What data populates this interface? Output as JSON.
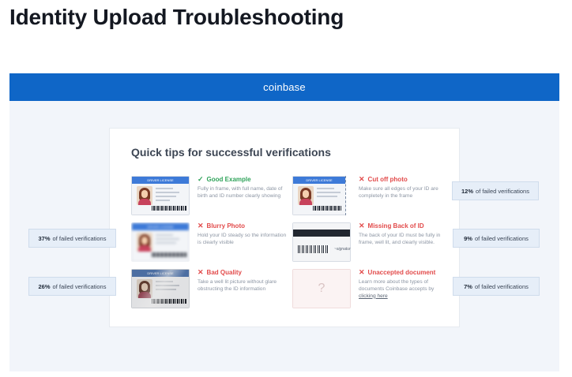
{
  "page": {
    "title": "Identity Upload Troubleshooting"
  },
  "topbar": {
    "brand": "coinbase"
  },
  "card": {
    "title": "Quick tips for successful verifications",
    "tips": [
      {
        "heading": "Good Example",
        "status": "good",
        "icon": "check-icon",
        "description": "Fully in frame, with full name, date of birth and ID number clearly showing",
        "image": "driver-license"
      },
      {
        "heading": "Cut off photo",
        "status": "bad",
        "icon": "cross-icon",
        "description": "Make sure all edges of your ID are completely in the frame",
        "image": "driver-license-cropped"
      },
      {
        "heading": "Blurry Photo",
        "status": "bad",
        "icon": "cross-icon",
        "description": "Hold your ID steady so the information is clearly visible",
        "image": "driver-license-blurry"
      },
      {
        "heading": "Missing Back of ID",
        "status": "bad",
        "icon": "cross-icon",
        "description": "The back of your ID must be fully in frame, well lit, and clearly visible.",
        "image": "license-back"
      },
      {
        "heading": "Bad Quality",
        "status": "bad",
        "icon": "cross-icon",
        "description": "Take a well lit picture without glare obstructing the ID information",
        "image": "driver-license-glare"
      },
      {
        "heading": "Unaccepted document",
        "status": "bad",
        "icon": "cross-icon",
        "description_pre": "Learn more about the types of documents Coinbase accepts by ",
        "link": "clicking here",
        "image": "unknown-document"
      }
    ],
    "license_label": "DRIVER LICENSE",
    "unknown_glyph": "?"
  },
  "stats": {
    "blurry": {
      "value": "37%",
      "label": "of failed verifications"
    },
    "bad_quality": {
      "value": "26%",
      "label": "of failed verifications"
    },
    "cut_off": {
      "value": "12%",
      "label": "of failed verifications"
    },
    "missing_back": {
      "value": "9%",
      "label": "of failed verifications"
    },
    "unaccepted": {
      "value": "7%",
      "label": "of failed verifications"
    }
  },
  "colors": {
    "brand_blue": "#0f66c7",
    "good": "#2fa35a",
    "bad": "#e24b4b",
    "stat_bg": "#e6eef8"
  }
}
